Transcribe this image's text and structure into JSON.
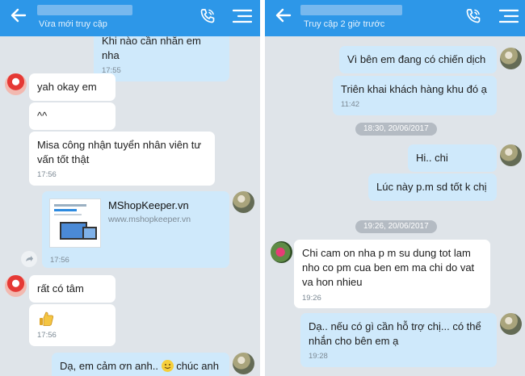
{
  "left": {
    "header": {
      "status": "Vừa mới truy cập"
    },
    "messages": [
      {
        "text": "Khi nào cần nhắn em nha",
        "time": "17:55"
      },
      {
        "text": "yah okay em"
      },
      {
        "text": "^^"
      },
      {
        "text": "Misa công nhận tuyển nhân viên tư vấn tốt thật",
        "time": "17:56"
      },
      {
        "text": "rất có tâm"
      },
      {
        "time": "17:56"
      },
      {
        "text": "Dạ, em cảm ơn anh..",
        "text_after": " chúc anh"
      }
    ],
    "link_card": {
      "title": "MShopKeeper.vn",
      "url": "www.mshopkeeper.vn",
      "time": "17:56"
    }
  },
  "right": {
    "header": {
      "status": "Truy cập 2 giờ trước"
    },
    "messages": [
      {
        "text": "Vì bên em đang có chiến dịch"
      },
      {
        "text": "Triên khai khách hàng khu đó ạ",
        "time": "11:42"
      },
      {
        "text": "Hi.. chi"
      },
      {
        "text": "Lúc này p.m sd tốt k chị"
      },
      {
        "text": "Chi cam on nha p m su dung tot lam nho co pm cua ben em ma chi do vat va hon nhieu",
        "time": "19:26"
      },
      {
        "text": "Dạ.. nếu có gì cần hỗ trợ chị... có thể nhắn cho bên em ạ",
        "time": "19:28"
      }
    ],
    "separators": [
      "18:30, 20/06/2017",
      "19:26, 20/06/2017"
    ]
  },
  "colors": {
    "header": "#2d97e8",
    "chat_bg": "#dfe4e9",
    "bubble_in": "#ffffff",
    "bubble_out": "#cfe9fb"
  },
  "icons": [
    "back-arrow-icon",
    "phone-icon",
    "menu-icon",
    "share-icon",
    "thumbs-up-sticker-icon",
    "smile-emoji-icon"
  ]
}
